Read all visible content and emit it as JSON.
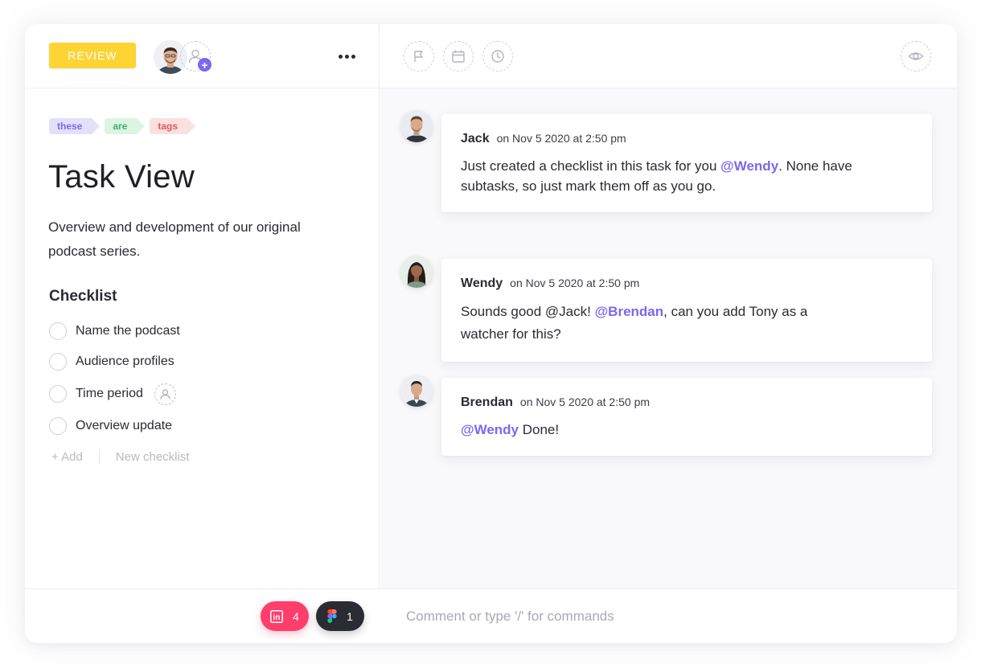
{
  "task": {
    "status": "REVIEW",
    "tags": [
      {
        "label": "these",
        "bg": "#e3e0fa",
        "color": "#7b68ee"
      },
      {
        "label": "are",
        "bg": "#dcf5e3",
        "color": "#3fae69"
      },
      {
        "label": "tags",
        "bg": "#fbe0e0",
        "color": "#e05a5a"
      }
    ],
    "title": "Task View",
    "description": "Overview and development of our original podcast series."
  },
  "checklist": {
    "title": "Checklist",
    "items": [
      "Name the podcast",
      "Audience profiles",
      "Time period",
      "Overview update"
    ],
    "add_label": "+ Add",
    "new_checklist_label": "New checklist"
  },
  "attachments": {
    "invision_count": "4",
    "figma_count": "1"
  },
  "header_icons": [
    "flag-icon",
    "calendar-icon",
    "clock-icon",
    "eye-icon"
  ],
  "comments": [
    {
      "author": "Jack",
      "time": "on Nov 5 2020 at 2:50 pm",
      "parts": [
        "Just created a checklist in this task for you ",
        "@Wendy",
        ". None have subtasks, so just mark them off as you go."
      ]
    },
    {
      "author": "Wendy",
      "time": "on Nov 5 2020 at 2:50 pm",
      "parts": [
        "Sounds good @Jack! ",
        "@Brendan",
        ", can you add Tony as a watcher for this?"
      ]
    },
    {
      "author": "Brendan",
      "time": "on Nov 5 2020 at 2:50 pm",
      "parts": [
        "@Wendy",
        " Done!"
      ]
    }
  ],
  "comment_input": {
    "placeholder": "Comment or type '/' for commands"
  },
  "colors": {
    "accent": "#7b68ee",
    "status_yellow": "#fcd535",
    "invision_pink": "#ff3e6c",
    "figma_dark": "#2b2b33"
  }
}
